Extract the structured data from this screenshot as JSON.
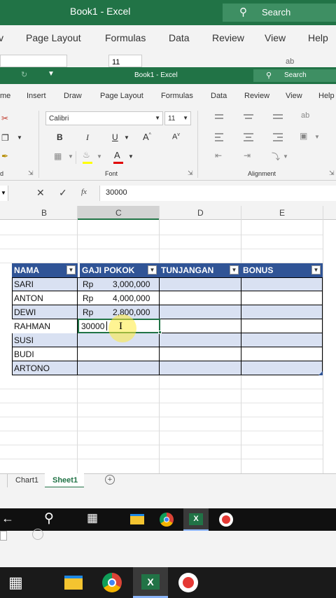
{
  "background_window": {
    "title": "Book1  -  Excel",
    "search": "Search",
    "tabs": [
      "Page Layout",
      "Formulas",
      "Data",
      "Review",
      "View",
      "Help"
    ],
    "partial_font_size": "11",
    "partial_glyph": "ab"
  },
  "window": {
    "title": "Book1  -  Excel",
    "search": "Search",
    "menu": [
      "me",
      "Insert",
      "Draw",
      "Page Layout",
      "Formulas",
      "Data",
      "Review",
      "View",
      "Help"
    ]
  },
  "ribbon": {
    "font_name": "Calibri",
    "font_size": "11",
    "bold": "B",
    "italic": "I",
    "underline": "U",
    "grow": "A",
    "shrink": "A",
    "font_color": "A",
    "group_font": "Font",
    "group_alignment": "Alignment",
    "group_left_partial": "d",
    "wrap_glyph": "ab"
  },
  "formula_bar": {
    "fx": "fx",
    "value": "30000"
  },
  "columns": [
    "B",
    "C",
    "D",
    "E"
  ],
  "table": {
    "headers": [
      "NAMA",
      "GAJI POKOK",
      "TUNJANGAN",
      "BONUS"
    ],
    "rows": [
      {
        "name": "SARI",
        "cur": "Rp",
        "amount": "3,000,000"
      },
      {
        "name": "ANTON",
        "cur": "Rp",
        "amount": "4,000,000"
      },
      {
        "name": "DEWI",
        "cur": "Rp",
        "amount": "2,800,000"
      },
      {
        "name": "RAHMAN",
        "edit": "30000"
      },
      {
        "name": "SUSI"
      },
      {
        "name": "BUDI"
      },
      {
        "name": "ARTONO"
      }
    ]
  },
  "sheets": {
    "tab1": "Chart1",
    "tab2": "Sheet1",
    "add": "+"
  },
  "colors": {
    "excel_green": "#217346",
    "table_header": "#305496",
    "table_band": "#d9e1f2"
  }
}
